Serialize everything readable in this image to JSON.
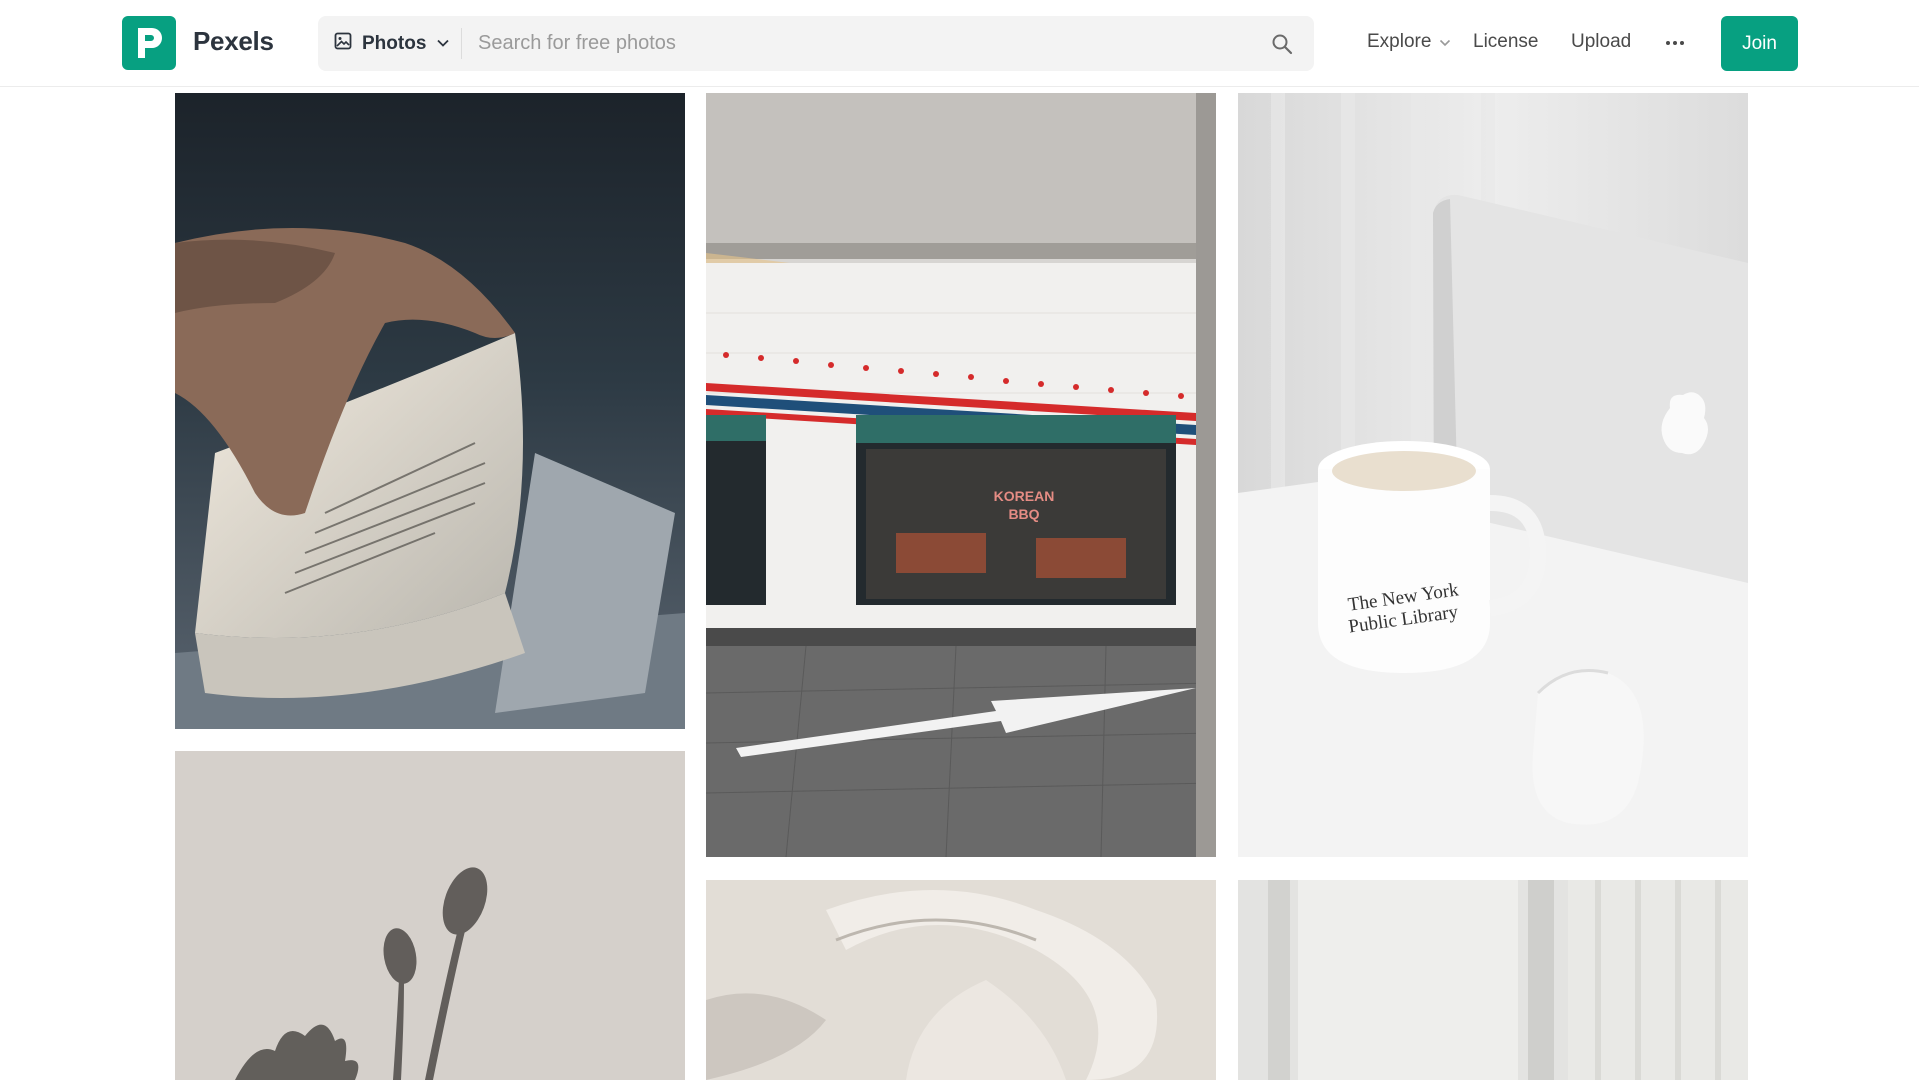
{
  "header": {
    "brand": "Pexels",
    "media_type": "Photos",
    "search_placeholder": "Search for free photos",
    "nav": {
      "explore": "Explore",
      "license": "License",
      "upload": "Upload"
    },
    "join_label": "Join"
  },
  "colors": {
    "accent": "#07a081",
    "search_bg": "#f3f3f3"
  },
  "icons": [
    "pexels-logo-icon",
    "image-icon",
    "chevron-down-icon",
    "search-icon",
    "more-dots-icon"
  ],
  "photos": [
    {
      "name": "photo-book-pages",
      "text": ""
    },
    {
      "name": "photo-korean-bbq-storefront",
      "text": "KOREAN BBQ"
    },
    {
      "name": "photo-nyc-library-mug-laptop",
      "text": "The New York Public Library"
    },
    {
      "name": "photo-flower-shadow-wall",
      "text": ""
    },
    {
      "name": "photo-white-fabric",
      "text": ""
    },
    {
      "name": "photo-white-curtain-wall",
      "text": ""
    }
  ]
}
